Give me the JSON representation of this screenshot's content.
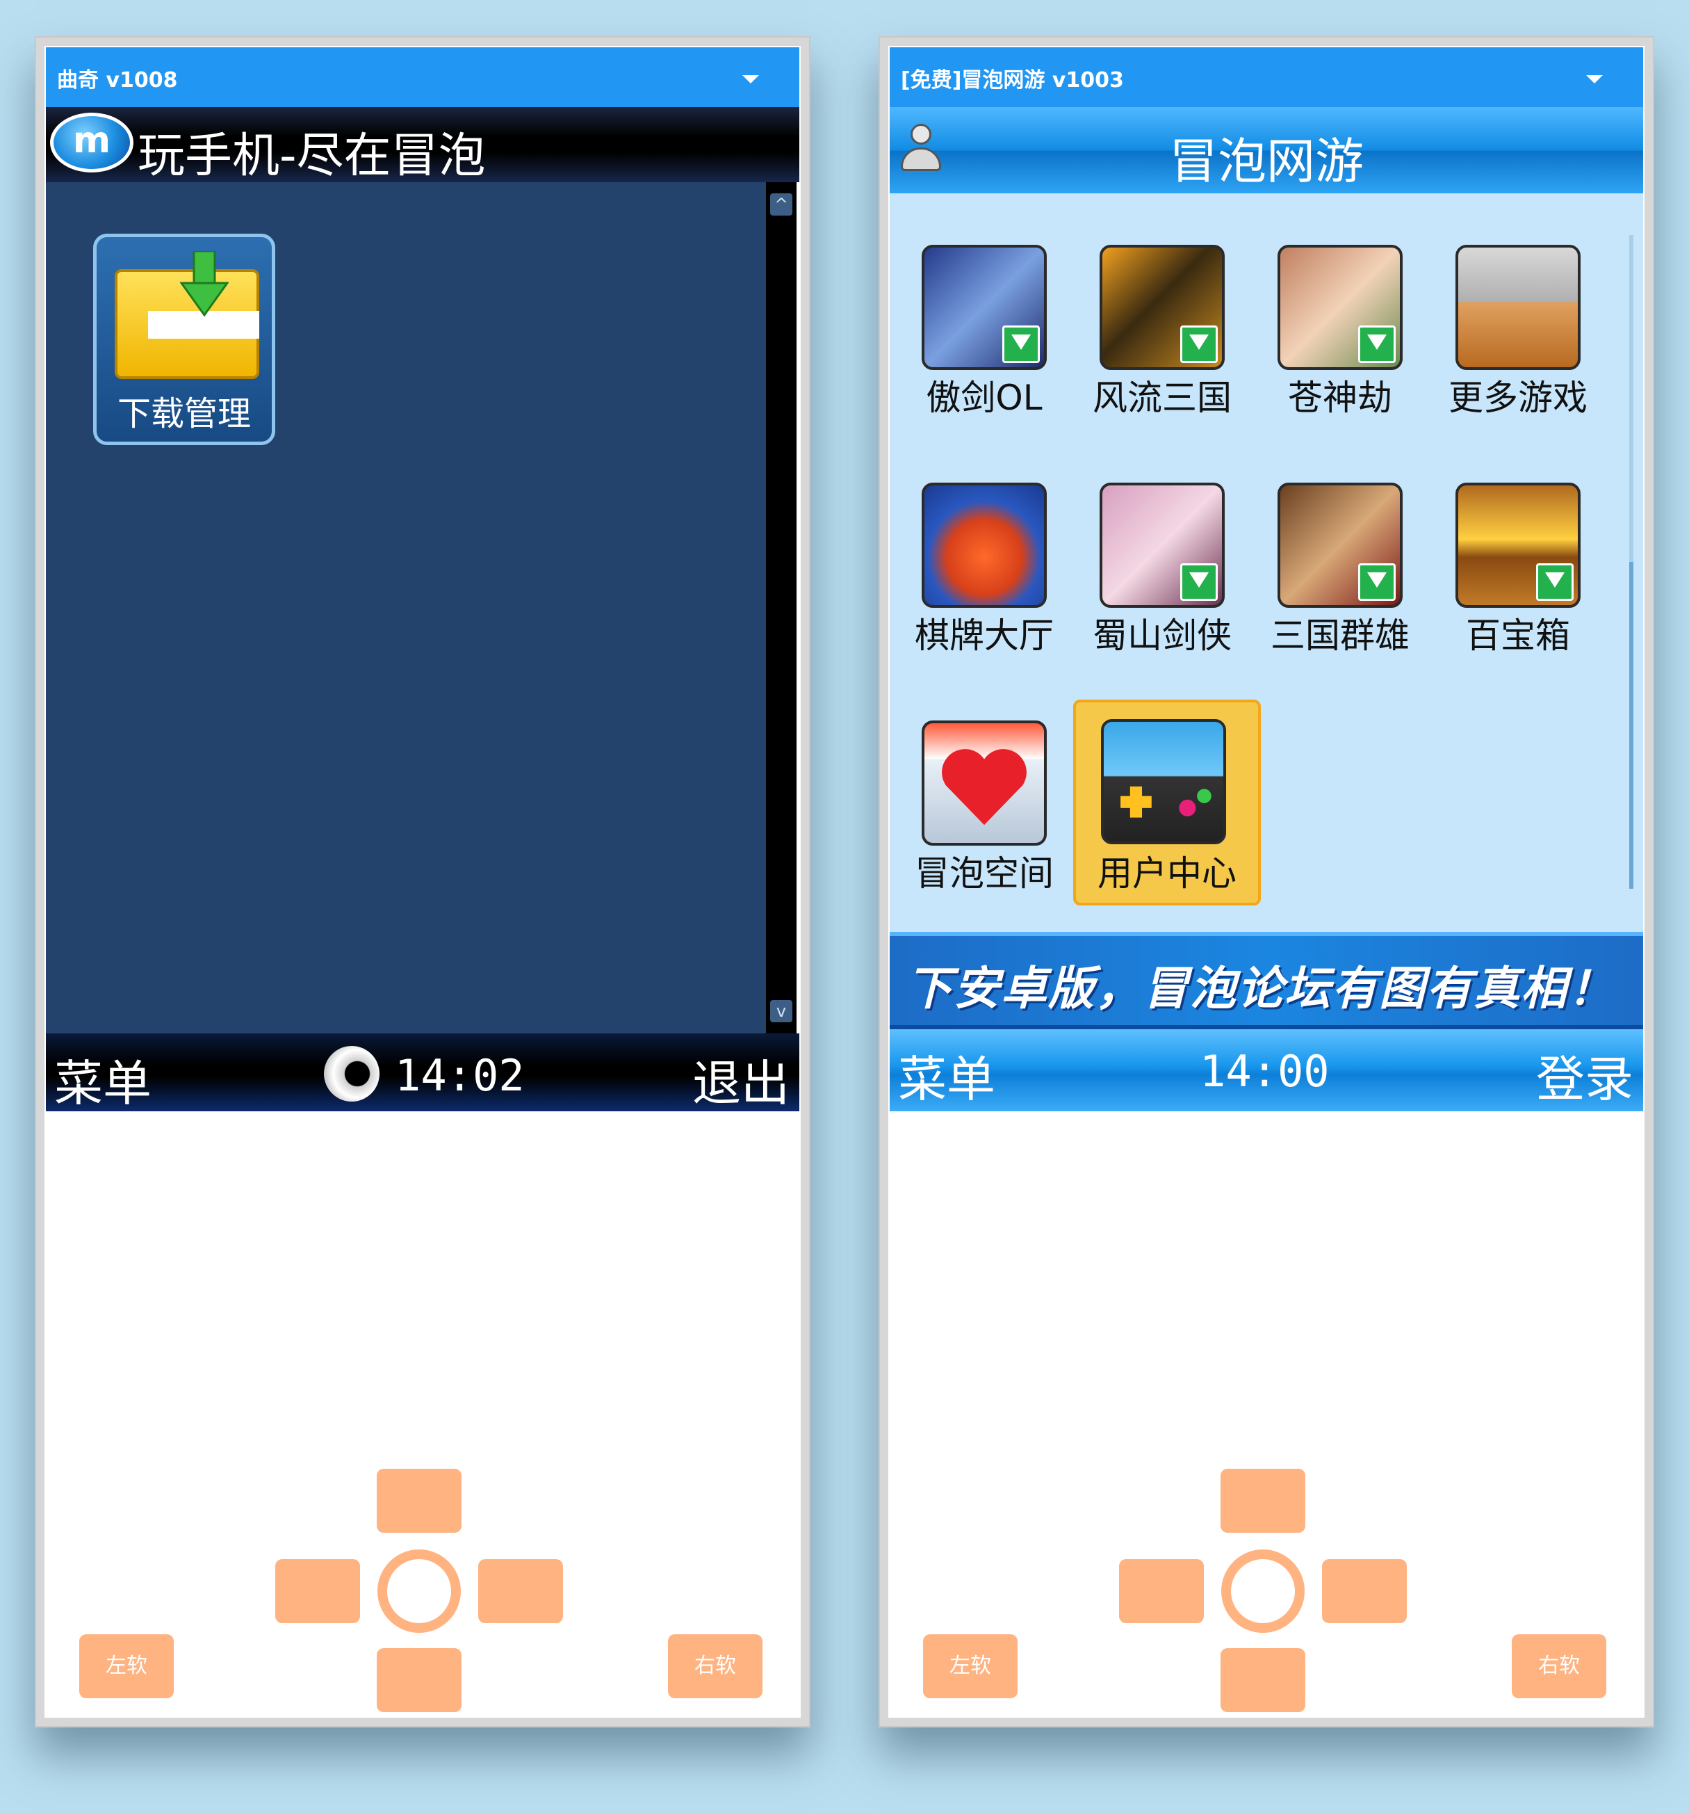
{
  "left_phone": {
    "window_title": "曲奇 v1008",
    "header_slogan": "玩手机-尽在冒泡",
    "logo_letter": "m",
    "app_tile_label": "下载管理",
    "softkey_left": "菜单",
    "softkey_right": "退出",
    "clock": "14:02",
    "keypad": {
      "left_soft": "左软",
      "right_soft": "右软"
    }
  },
  "right_phone": {
    "window_title": "[免费]冒泡网游 v1003",
    "header_title": "冒泡网游",
    "games": [
      {
        "label": "傲剑OL",
        "download": true
      },
      {
        "label": "风流三国",
        "download": true
      },
      {
        "label": "苍神劫",
        "download": true
      },
      {
        "label": "更多游戏",
        "download": false
      },
      {
        "label": "棋牌大厅",
        "download": false
      },
      {
        "label": "蜀山剑侠",
        "download": true
      },
      {
        "label": "三国群雄",
        "download": true
      },
      {
        "label": "百宝箱",
        "download": true
      },
      {
        "label": "冒泡空间",
        "download": false
      },
      {
        "label": "用户中心",
        "download": false,
        "selected": true
      }
    ],
    "banner_text": "下安卓版，冒泡论坛有图有真相！",
    "softkey_left": "菜单",
    "softkey_right": "登录",
    "clock": "14:00",
    "keypad": {
      "left_soft": "左软",
      "right_soft": "右软"
    }
  },
  "colors": {
    "titlebar": "#2196f3",
    "left_content_bg": "#23436d",
    "right_content_bg": "#c7e6fb",
    "keypad": "#ffb381",
    "page_bg": "#b9def0"
  }
}
